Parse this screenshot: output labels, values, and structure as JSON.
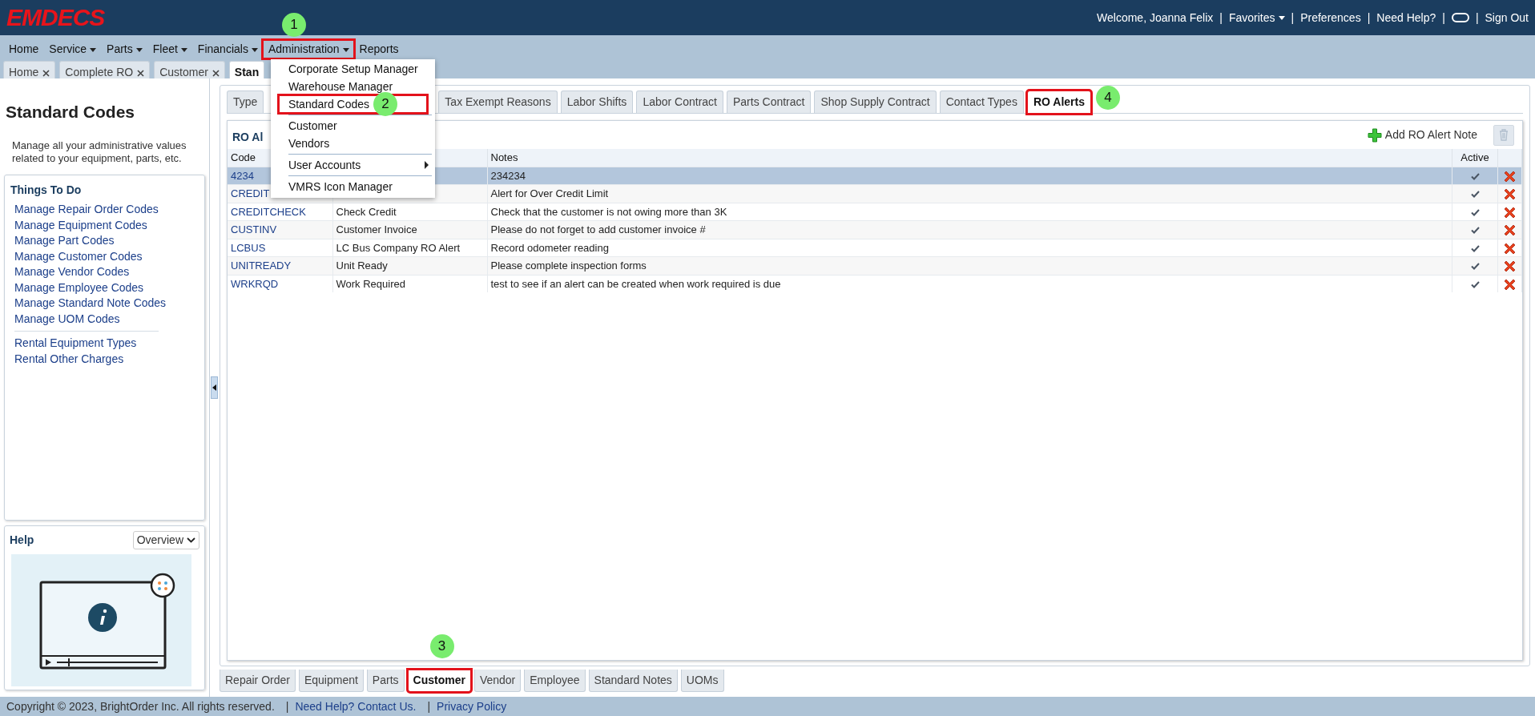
{
  "header": {
    "logo": "EMDECS",
    "items": [
      {
        "kind": "text",
        "text": "Welcome, Joanna Felix"
      },
      {
        "kind": "sep",
        "text": "|"
      },
      {
        "kind": "dropdown",
        "text": "Favorites"
      },
      {
        "kind": "sep",
        "text": "|"
      },
      {
        "kind": "link",
        "text": "Preferences"
      },
      {
        "kind": "sep",
        "text": "|"
      },
      {
        "kind": "link",
        "text": "Need Help?"
      },
      {
        "kind": "sep",
        "text": "|"
      },
      {
        "kind": "toggle"
      },
      {
        "kind": "sep",
        "text": "|"
      },
      {
        "kind": "link",
        "text": "Sign Out"
      }
    ]
  },
  "nav": [
    {
      "label": "Home",
      "dropdown": false,
      "highlighted": false
    },
    {
      "label": "Service",
      "dropdown": true,
      "highlighted": false
    },
    {
      "label": "Parts",
      "dropdown": true,
      "highlighted": false
    },
    {
      "label": "Fleet",
      "dropdown": true,
      "highlighted": false
    },
    {
      "label": "Financials",
      "dropdown": true,
      "highlighted": false
    },
    {
      "label": "Administration",
      "dropdown": true,
      "highlighted": true,
      "callout": "1",
      "menu": [
        {
          "label": "Corporate Setup Manager",
          "separator_above": false,
          "submenu": false,
          "highlighted": false
        },
        {
          "label": "Warehouse Manager",
          "separator_above": false,
          "submenu": false,
          "highlighted": false
        },
        {
          "label": "Standard Codes",
          "separator_above": false,
          "submenu": false,
          "highlighted": true,
          "callout": "2"
        },
        {
          "label": "Customer",
          "separator_above": true,
          "submenu": false,
          "highlighted": false
        },
        {
          "label": "Vendors",
          "separator_above": false,
          "submenu": false,
          "highlighted": false
        },
        {
          "label": "User Accounts",
          "separator_above": true,
          "submenu": true,
          "highlighted": false
        },
        {
          "label": "VMRS Icon Manager",
          "separator_above": true,
          "submenu": false,
          "highlighted": false
        }
      ]
    },
    {
      "label": "Reports",
      "dropdown": false,
      "highlighted": false
    }
  ],
  "open_tabs": [
    {
      "label": "Home",
      "closable": true,
      "selected": false
    },
    {
      "label": "Complete RO",
      "closable": true,
      "selected": false
    },
    {
      "label": "Customer",
      "closable": true,
      "selected": false
    },
    {
      "label": "Stan",
      "closable": false,
      "selected": true
    }
  ],
  "sidebar": {
    "title": "Standard Codes",
    "description": "Manage all your administrative values related to your equipment, parts, etc.",
    "things_to_do": {
      "title": "Things To Do",
      "groups": [
        [
          "Manage Repair Order Codes",
          "Manage Equipment Codes",
          "Manage Part Codes",
          "Manage Customer Codes",
          "Manage Vendor Codes",
          "Manage Employee Codes",
          "Manage Standard Note Codes",
          "Manage UOM Codes"
        ],
        [
          "Rental Equipment Types",
          "Rental Other Charges"
        ]
      ]
    },
    "help": {
      "title": "Help",
      "select": "Overview"
    }
  },
  "code_tabs": [
    {
      "label": "Type",
      "selected": false,
      "highlighted": false
    },
    {
      "label": "Tax Exempt Reasons",
      "selected": false,
      "highlighted": false
    },
    {
      "label": "Labor Shifts",
      "selected": false,
      "highlighted": false
    },
    {
      "label": "Labor Contract",
      "selected": false,
      "highlighted": false
    },
    {
      "label": "Parts Contract",
      "selected": false,
      "highlighted": false
    },
    {
      "label": "Shop Supply Contract",
      "selected": false,
      "highlighted": false
    },
    {
      "label": "Contact Types",
      "selected": false,
      "highlighted": false
    },
    {
      "label": "RO Alerts",
      "selected": true,
      "highlighted": true,
      "callout": "4"
    }
  ],
  "table": {
    "title": "RO Al",
    "add_button": "Add RO Alert Note",
    "delete_disabled": true,
    "columns": {
      "code": "Code",
      "notes": "Notes",
      "active": "Active"
    },
    "rows": [
      {
        "code": "4234",
        "notes": "234234",
        "active": true,
        "selected": true
      },
      {
        "code": "CREDIT",
        "notes": "Alert for Over Credit Limit",
        "active": true,
        "selected": false
      },
      {
        "code": "CREDITCHECK",
        "description": "Check Credit",
        "notes": "Check that the customer is not owing more than 3K",
        "active": true,
        "selected": false
      },
      {
        "code": "CUSTINV",
        "description": "Customer Invoice",
        "notes": "Please do not forget to add customer invoice #",
        "active": true,
        "selected": false
      },
      {
        "code": "LCBUS",
        "description": "LC Bus Company RO Alert",
        "notes": "Record odometer reading",
        "active": true,
        "selected": false
      },
      {
        "code": "UNITREADY",
        "description": "Unit Ready",
        "notes": "Please complete inspection forms",
        "active": true,
        "selected": false
      },
      {
        "code": "WRKRQD",
        "description": "Work Required",
        "notes": "test to see if an alert can be created when work required is due",
        "active": true,
        "selected": false
      }
    ]
  },
  "bottom_tabs": [
    {
      "label": "Repair Order",
      "selected": false,
      "highlighted": false
    },
    {
      "label": "Equipment",
      "selected": false,
      "highlighted": false
    },
    {
      "label": "Parts",
      "selected": false,
      "highlighted": false
    },
    {
      "label": "Customer",
      "selected": true,
      "highlighted": true,
      "callout": "3"
    },
    {
      "label": "Vendor",
      "selected": false,
      "highlighted": false
    },
    {
      "label": "Employee",
      "selected": false,
      "highlighted": false
    },
    {
      "label": "Standard Notes",
      "selected": false,
      "highlighted": false
    },
    {
      "label": "UOMs",
      "selected": false,
      "highlighted": false
    }
  ],
  "footer": [
    {
      "kind": "text",
      "text": "Copyright © 2023, BrightOrder Inc. All rights reserved."
    },
    {
      "kind": "sep",
      "text": "|"
    },
    {
      "kind": "link",
      "text": "Need Help? Contact Us."
    },
    {
      "kind": "sep",
      "text": "|"
    },
    {
      "kind": "link",
      "text": "Privacy Policy"
    }
  ]
}
